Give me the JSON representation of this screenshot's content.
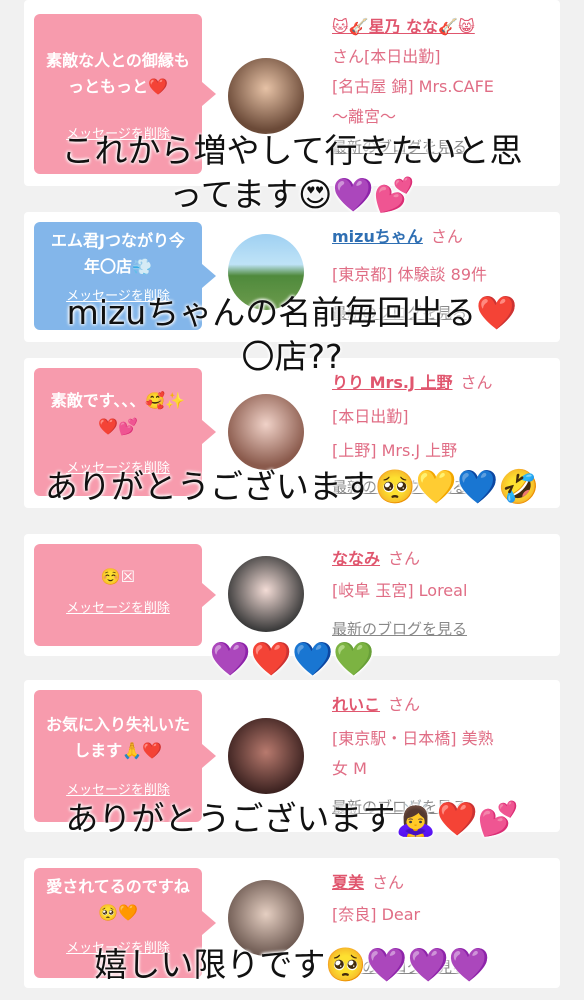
{
  "cards": [
    {
      "bubble": "素敵な人との御縁もっともっと❤️",
      "delete": "メッセージを削除",
      "name": "🐱🎸星乃 なな🎸😸",
      "san": "さん[本日出勤]",
      "line1": "[名古屋 錦] Mrs.CAFE",
      "line2": "〜離宮〜",
      "blog": "最新のブログを見る"
    },
    {
      "bubble": "エム君Jつながり今年〇店💨",
      "delete": "メッセージを削除",
      "name": "mizuちゃん",
      "san": "さん",
      "line1": "[東京都] 体験談 89件",
      "blog": "最新のブログを見る"
    },
    {
      "bubble": "素敵です、、、🥰✨❤️💕",
      "delete": "メッセージを削除",
      "name": "りり Mrs.J 上野",
      "san": "さん",
      "line1": "[本日出勤]",
      "line2": "[上野] Mrs.J 上野",
      "blog": "最新のブログを見る"
    },
    {
      "bubble": "☺️☒",
      "delete": "メッセージを削除",
      "name": "ななみ",
      "san": "さん",
      "line1": "[岐阜 玉宮] Loreal",
      "blog": "最新のブログを見る"
    },
    {
      "bubble": "お気に入り失礼いたします🙏❤️",
      "delete": "メッセージを削除",
      "name": "れいこ",
      "san": "さん",
      "line1": "[東京駅・日本橋] 美熟",
      "line2": "女 M",
      "blog": "最新のブログを見る"
    },
    {
      "bubble": "愛されてるのですね🥺🧡",
      "delete": "メッセージを削除",
      "name": "夏美",
      "san": "さん",
      "line1": "[奈良] Dear",
      "blog": "最新のブログを見る"
    }
  ],
  "overlays": {
    "o1a": "これから増やして行きたいと思",
    "o1b": "ってます😍💜💕",
    "o2a": "mizuちゃんの名前毎回出る❤️",
    "o2b": "〇店??",
    "o3": "ありがとうございます🥺💛💙🤣",
    "o4": "💜❤️💙💚",
    "o5": "ありがとうございます🙇‍♀️❤️💕",
    "o6": "嬉しい限りです🥺💜💜💜"
  },
  "colors": {
    "bubble_pink": "#f79bad",
    "bubble_blue": "#83b6ea",
    "name_pink": "#e0566e",
    "name_blue": "#2f6fb3"
  }
}
